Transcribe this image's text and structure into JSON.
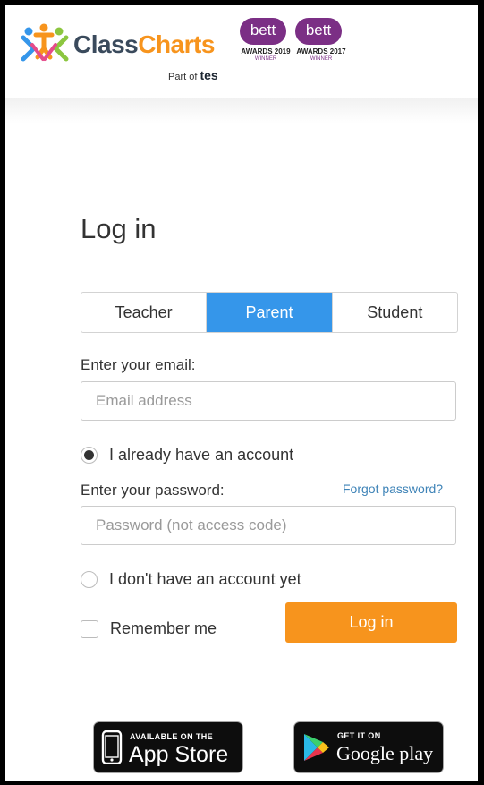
{
  "header": {
    "logo_word_1": "Class",
    "logo_word_2": "Charts",
    "logo_sub_prefix": "Part of",
    "logo_sub_brand": "tes",
    "awards": [
      {
        "badge": "bett",
        "line1": "AWARDS 2019",
        "line2": "WINNER"
      },
      {
        "badge": "bett",
        "line1": "AWARDS 2017",
        "line2": "WINNER"
      }
    ]
  },
  "login": {
    "title": "Log in",
    "tabs": [
      {
        "label": "Teacher",
        "active": false
      },
      {
        "label": "Parent",
        "active": true
      },
      {
        "label": "Student",
        "active": false
      }
    ],
    "email_label": "Enter your email:",
    "email_placeholder": "Email address",
    "email_value": "",
    "has_account_label": "I already have an account",
    "has_account_selected": true,
    "password_label": "Enter your password:",
    "forgot_password": "Forgot password?",
    "password_placeholder": "Password (not access code)",
    "password_value": "",
    "no_account_label": "I don't have an account yet",
    "no_account_selected": false,
    "remember_label": "Remember me",
    "remember_checked": false,
    "submit_label": "Log in"
  },
  "stores": {
    "app_store": {
      "small": "AVAILABLE ON THE",
      "big": "App Store",
      "icon": "phone-icon"
    },
    "google_play": {
      "small": "GET IT ON",
      "big": "Google play",
      "icon": "play-triangle-icon"
    }
  },
  "colors": {
    "accent_blue": "#3596ea",
    "accent_orange": "#f7941d",
    "link_blue": "#3e83b7",
    "award_purple": "#7b2f85"
  }
}
